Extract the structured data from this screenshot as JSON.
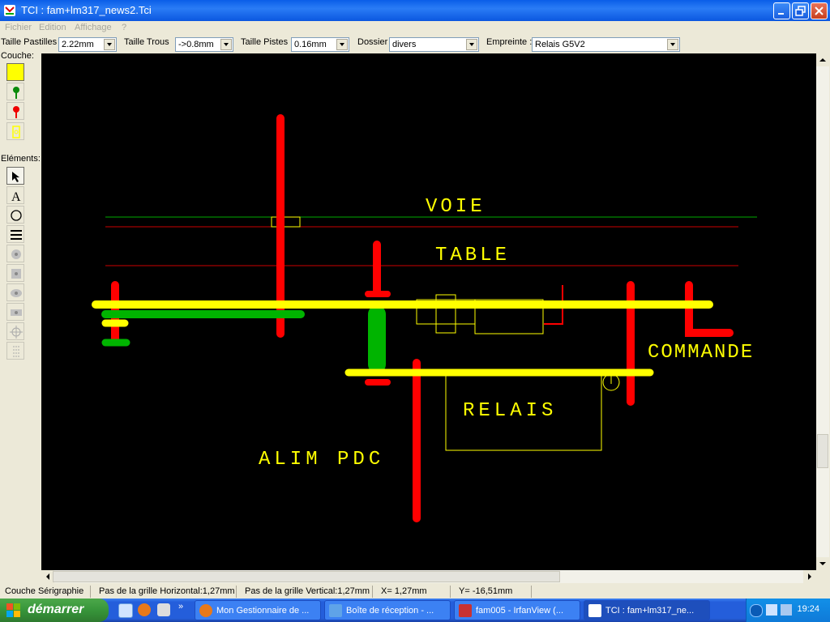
{
  "window": {
    "title": "TCI : fam+lm317_news2.Tci"
  },
  "menu": [
    "Fichier",
    "Edition",
    "Affichage",
    "?"
  ],
  "toolbar": {
    "pastilles_label": "Taille Pastilles",
    "pastilles_value": "2.22mm",
    "trous_label": "Taille Trous",
    "trous_value": "->0.8mm",
    "pistes_label": "Taille Pistes",
    "pistes_value": "0.16mm",
    "dossier_label": "Dossier",
    "dossier_value": "divers",
    "empreinte_label": "Empreinte :",
    "empreinte_value": "Relais G5V2"
  },
  "left_panel": {
    "couche_label": "Couche:",
    "elements_label": "Eléments:",
    "layers": [
      "yellow-layer",
      "green-layer",
      "red-layer",
      "outline-layer"
    ],
    "tools": [
      "pointer-icon",
      "text-icon",
      "circle-icon",
      "lines-icon",
      "pad-round-icon",
      "pad-square-icon",
      "pad-oval-icon",
      "pad-rect-icon",
      "target-icon",
      "dots-icon"
    ]
  },
  "canvas": {
    "labels": {
      "voie": "VOIE",
      "table": "TABLE",
      "commande": "COMMANDE",
      "relais": "RELAIS",
      "alim": "ALIM PDC"
    },
    "colors": {
      "background": "#000000",
      "red": "#ff0000",
      "yellow": "#ffff00",
      "green": "#00b400",
      "silk": "#ffff00"
    }
  },
  "status": {
    "layer": "Couche Sérigraphie",
    "grid_h": "Pas de la grille Horizontal:1,27mm",
    "grid_v": "Pas de la grille Vertical:1,27mm",
    "x": "X= 1,27mm",
    "y": "Y= -16,51mm"
  },
  "taskbar": {
    "start_label": "démarrer",
    "tasks": [
      {
        "label": "Mon Gestionnaire de ...",
        "icon": "firefox-icon"
      },
      {
        "label": "Boîte de réception - ...",
        "icon": "mail-icon"
      },
      {
        "label": "fam005 - IrfanView (...",
        "icon": "irfanview-icon"
      },
      {
        "label": "TCI : fam+lm317_ne...",
        "icon": "tci-icon"
      }
    ],
    "clock": "19:24"
  }
}
